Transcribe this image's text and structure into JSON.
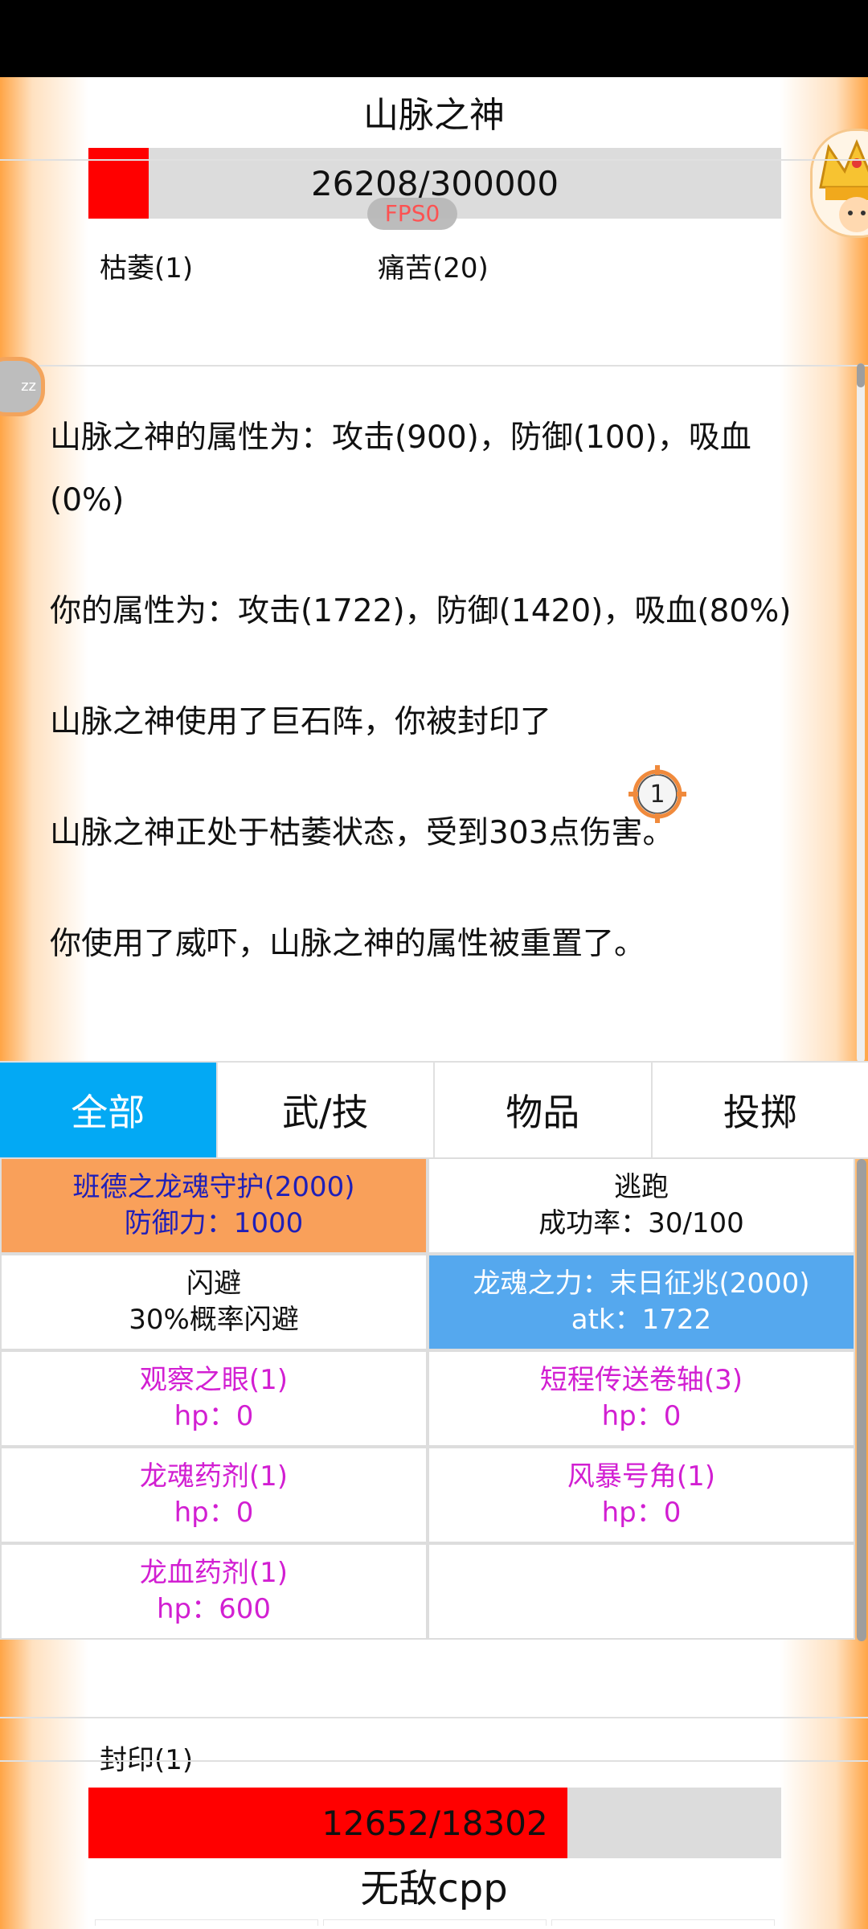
{
  "enemy": {
    "name": "山脉之神",
    "hp_text": "26208/300000",
    "hp_fraction": 0.087,
    "status_effects": [
      "枯萎(1)",
      "痛苦(20)"
    ]
  },
  "fps_label": "FPS0",
  "zz_label": "zz",
  "battle_log": [
    "山脉之神的属性为：攻击(900)，防御(100)，吸血(0%)",
    "你的属性为：攻击(1722)，防御(1420)，吸血(80%)",
    "山脉之神使用了巨石阵，你被封印了",
    "山脉之神正处于枯萎状态，受到303点伤害。",
    "你使用了威吓，山脉之神的属性被重置了。"
  ],
  "seal_counter": "1",
  "tabs": [
    "全部",
    "武/技",
    "物品",
    "投掷"
  ],
  "actions": [
    {
      "name": "班德之龙魂守护(2000)",
      "detail": "防御力：1000"
    },
    {
      "name": "逃跑",
      "detail": "成功率：30/100"
    },
    {
      "name": "闪避",
      "detail": "30%概率闪避"
    },
    {
      "name": "龙魂之力：末日征兆(2000)",
      "detail": "atk：1722"
    },
    {
      "name": "观察之眼(1)",
      "detail": "hp：0"
    },
    {
      "name": "短程传送卷轴(3)",
      "detail": "hp：0"
    },
    {
      "name": "龙魂药剂(1)",
      "detail": "hp：0"
    },
    {
      "name": "风暴号角(1)",
      "detail": "hp：0"
    },
    {
      "name": "龙血药剂(1)",
      "detail": "hp：600"
    }
  ],
  "player": {
    "status_effects": [
      "封印(1)"
    ],
    "hp_text": "12652/18302",
    "hp_fraction": 0.691,
    "name": "无敌cpp"
  },
  "colors": {
    "hp_fill": "#ff0000",
    "tab_active": "#03a9f4",
    "defense_skill_bg": "#f9a05a",
    "attack_skill_bg": "#55a8ee",
    "item_text": "#d21fd2"
  }
}
